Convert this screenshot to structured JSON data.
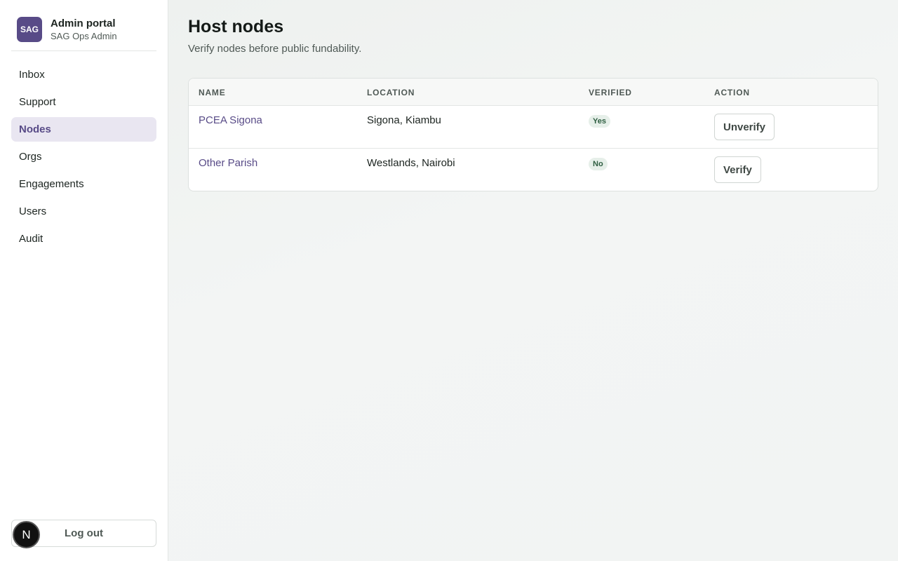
{
  "brand": {
    "logo_text": "SAG",
    "title": "Admin portal",
    "subtitle": "SAG Ops Admin"
  },
  "nav": {
    "items": [
      {
        "label": "Inbox"
      },
      {
        "label": "Support"
      },
      {
        "label": "Nodes",
        "active": true
      },
      {
        "label": "Orgs"
      },
      {
        "label": "Engagements"
      },
      {
        "label": "Users"
      },
      {
        "label": "Audit"
      }
    ]
  },
  "logout_label": "Log out",
  "dev_badge": "N",
  "page": {
    "title": "Host nodes",
    "subtitle": "Verify nodes before public fundability."
  },
  "table": {
    "headers": {
      "name": "NAME",
      "location": "LOCATION",
      "verified": "VERIFIED",
      "action": "ACTION"
    },
    "rows": [
      {
        "name": "PCEA Sigona",
        "location": "Sigona, Kiambu",
        "verified": "Yes",
        "action": "Unverify"
      },
      {
        "name": "Other Parish",
        "location": "Westlands, Nairobi",
        "verified": "No",
        "action": "Verify"
      }
    ]
  },
  "colors": {
    "accent": "#584b87",
    "active_bg": "#e9e6f1",
    "pill_bg": "#e6efe9",
    "pill_text": "#2e5e41"
  }
}
